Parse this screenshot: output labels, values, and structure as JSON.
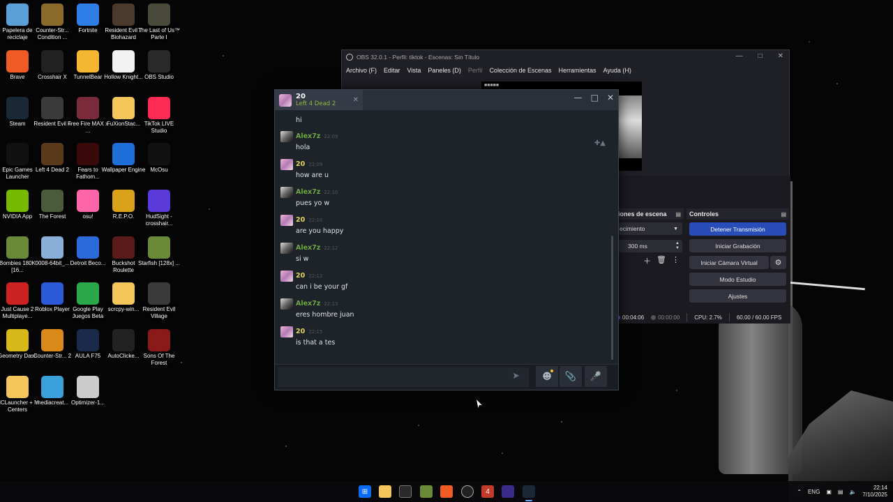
{
  "desktop_icons": [
    {
      "label": "Papelera de reciclaje",
      "color": "#5aa0d8"
    },
    {
      "label": "Counter-Str... Condition ...",
      "color": "#8a6a2a"
    },
    {
      "label": "Fortnite",
      "color": "#2f7ee6"
    },
    {
      "label": "Resident Evil 7 Biohazard",
      "color": "#4b3a2c"
    },
    {
      "label": "The Last of Us™ Parte I",
      "color": "#4a4a3a"
    },
    {
      "label": "Brave",
      "color": "#f05a24"
    },
    {
      "label": "Crosshair X",
      "color": "#222222"
    },
    {
      "label": "TunnelBear",
      "color": "#f5b632"
    },
    {
      "label": "Hollow Knight...",
      "color": "#f2f2f2"
    },
    {
      "label": "OBS Studio",
      "color": "#2a2a2a"
    },
    {
      "label": "Steam",
      "color": "#1b2838"
    },
    {
      "label": "Resident Evil 4",
      "color": "#3a3a3a"
    },
    {
      "label": "Free Fire MAX x ...",
      "color": "#7a2a3a"
    },
    {
      "label": "FuXionStac...",
      "color": "#f3c55a"
    },
    {
      "label": "TikTok LIVE Studio",
      "color": "#fe2c55"
    },
    {
      "label": "Epic Games Launcher",
      "color": "#111111"
    },
    {
      "label": "Left 4 Dead 2",
      "color": "#5a3a1a"
    },
    {
      "label": "Fears to Fathom...",
      "color": "#3a0a0a"
    },
    {
      "label": "Wallpaper Engine",
      "color": "#1e6fd9"
    },
    {
      "label": "McOsu",
      "color": "#111111"
    },
    {
      "label": "NVIDIA App",
      "color": "#76b900"
    },
    {
      "label": "The Forest",
      "color": "#4a5a3a"
    },
    {
      "label": "osu!",
      "color": "#ff66aa"
    },
    {
      "label": "R.E.P.O.",
      "color": "#d9a21a"
    },
    {
      "label": "HudSight - crosshair...",
      "color": "#5a3ad9"
    },
    {
      "label": "Bombies 180K [16...",
      "color": "#6a8a3a"
    },
    {
      "label": "0008-64bit_...",
      "color": "#8ab0d9"
    },
    {
      "label": "Detroit Beco...",
      "color": "#2a6ad9"
    },
    {
      "label": "Buckshot Roulette",
      "color": "#5a1a1a"
    },
    {
      "label": "Starfish [128x] ...",
      "color": "#6a8a3a"
    },
    {
      "label": "Just Cause 2 Multiplaye...",
      "color": "#cc2222"
    },
    {
      "label": "Roblox Player",
      "color": "#2a5ad9"
    },
    {
      "label": "Google Play Juegos Beta",
      "color": "#2aa84a"
    },
    {
      "label": "scrcpy-win...",
      "color": "#f3c55a"
    },
    {
      "label": "Resident Evil Village",
      "color": "#3a3a3a"
    },
    {
      "label": "Geometry Dash",
      "color": "#d9b81a"
    },
    {
      "label": "Counter-Str... 2",
      "color": "#d98a1a"
    },
    {
      "label": "AULA F75",
      "color": "#1a2a4a"
    },
    {
      "label": "AutoClicke...",
      "color": "#222222"
    },
    {
      "label": "Sons Of The Forest",
      "color": "#8a1a1a"
    },
    {
      "label": "MCLauncher + M Centers",
      "color": "#f3c55a"
    },
    {
      "label": "mediacreat...",
      "color": "#3aa0d9"
    },
    {
      "label": "Optimizer-1...",
      "color": "#cccccc"
    }
  ],
  "obs": {
    "title": "OBS 32.0.1 - Perfil: tiktok - Escenas: Sin Título",
    "menu": [
      "Archivo (F)",
      "Editar",
      "Vista",
      "Paneles (D)",
      "Perfil",
      "Colección de Escenas",
      "Herramientas",
      "Ayuda (H)"
    ],
    "transitions_header": "iones de escena",
    "transition_value": "ecimiento",
    "duration_value": "300 ms",
    "controls_header": "Controles",
    "controls": [
      "Detener Transmisión",
      "Iniciar Grabación",
      "Iniciar Cámara Virtual",
      "Modo Estudio",
      "Ajustes"
    ],
    "status": {
      "stream_time": "00:04:06",
      "rec_time": "00:00:00",
      "cpu": "CPU: 2.7%",
      "fps": "60.00 / 60.00 FPS"
    }
  },
  "chat": {
    "friend_tab_name": "20",
    "friend_tab_game": "Left 4 Dead 2",
    "first_partial_text": "hi",
    "messages": [
      {
        "sender": "Alex7z",
        "time": "22:09",
        "text": "hola",
        "type": "friend"
      },
      {
        "sender": "20",
        "time": "22:09",
        "text": "how are u",
        "type": "self"
      },
      {
        "sender": "Alex7z",
        "time": "22:10",
        "text": "pues yo w",
        "type": "friend"
      },
      {
        "sender": "20",
        "time": "22:10",
        "text": "are you happy",
        "type": "self"
      },
      {
        "sender": "Alex7z",
        "time": "22:12",
        "text": "si w",
        "type": "friend"
      },
      {
        "sender": "20",
        "time": "22:12",
        "text": "can i be your gf",
        "type": "self"
      },
      {
        "sender": "Alex7z",
        "time": "22:13",
        "text": "eres hombre juan",
        "type": "friend"
      },
      {
        "sender": "20",
        "time": "22:15",
        "text": "is that a tes",
        "type": "self"
      }
    ],
    "input_placeholder": ""
  },
  "taskbar": {
    "language": "ENG",
    "time": "22:14",
    "date": "7/10/2025"
  }
}
